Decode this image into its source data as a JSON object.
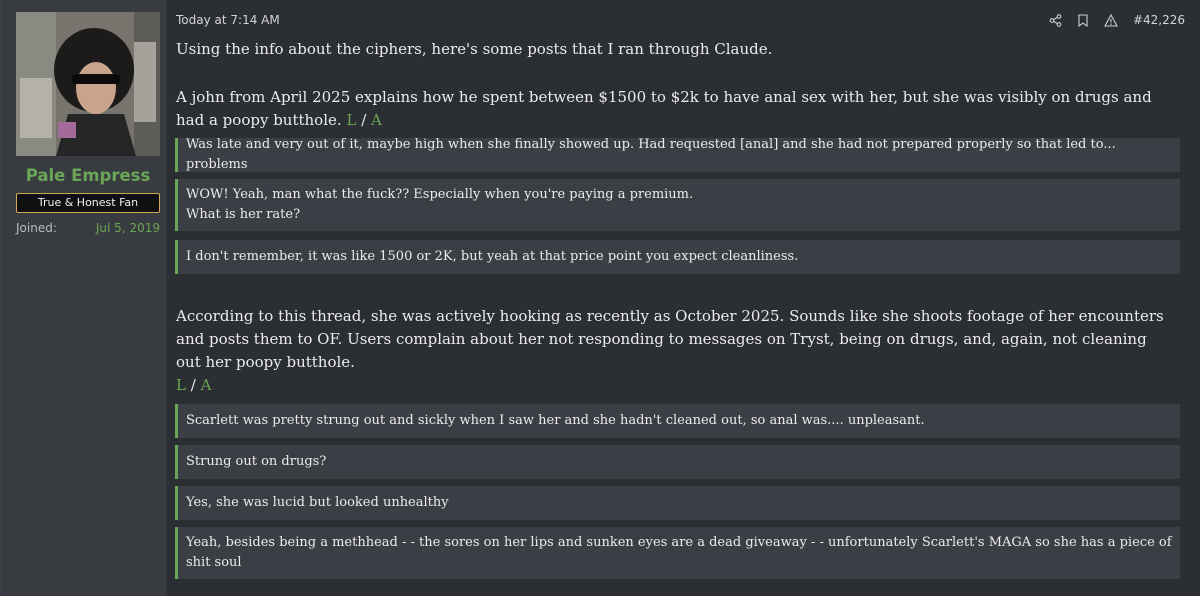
{
  "user": {
    "name": "Pale Empress",
    "title": "True & Honest Fan",
    "joined_label": "Joined:",
    "joined_date": "Jul 5, 2019"
  },
  "post": {
    "timestamp": "Today at 7:14 AM",
    "number": "#42,226",
    "intro": "Using the info about the ciphers, here's some posts that I ran through Claude.",
    "para1": "A john from April 2025 explains how he spent between $1500 to $2k to have anal sex with her, but she was visibly on drugs and had a poopy butthole.",
    "para2": "According to this thread, she was actively hooking as recently as October 2025. Sounds like she shoots footage of her encounters and posts them to OF. Users complain about her not responding to messages on Tryst, being on drugs, and, again, not cleaning out her poopy butthole.",
    "link_l": "L",
    "link_sep": "/",
    "link_a": "A",
    "quotes1": [
      "Was late and very out of it, maybe high when she finally showed up. Had requested [anal] and she had not prepared properly so that led to... problems",
      "WOW! Yeah, man what the fuck?? Especially when you're paying a premium.",
      "What is her rate?",
      "I don't remember, it was like 1500 or 2K, but yeah at that price point you expect cleanliness."
    ],
    "quotes2": [
      "Scarlett was pretty strung out and sickly when I saw her and she hadn't cleaned out, so anal was.... unpleasant.",
      "Strung out on drugs?",
      "Yes, she was lucid but looked unhealthy",
      "Yeah, besides being a methhead - - the sores on her lips and sunken eyes are a dead giveaway - - unfortunately Scarlett's MAGA so she has a piece of shit soul"
    ]
  },
  "icons": [
    "share-icon",
    "bookmark-icon",
    "report-icon"
  ],
  "colors": {
    "accent": "#6aa657",
    "badge_border": "#d2a94a",
    "background": "#2b2e32",
    "quote_bg": "#3b3e44"
  }
}
